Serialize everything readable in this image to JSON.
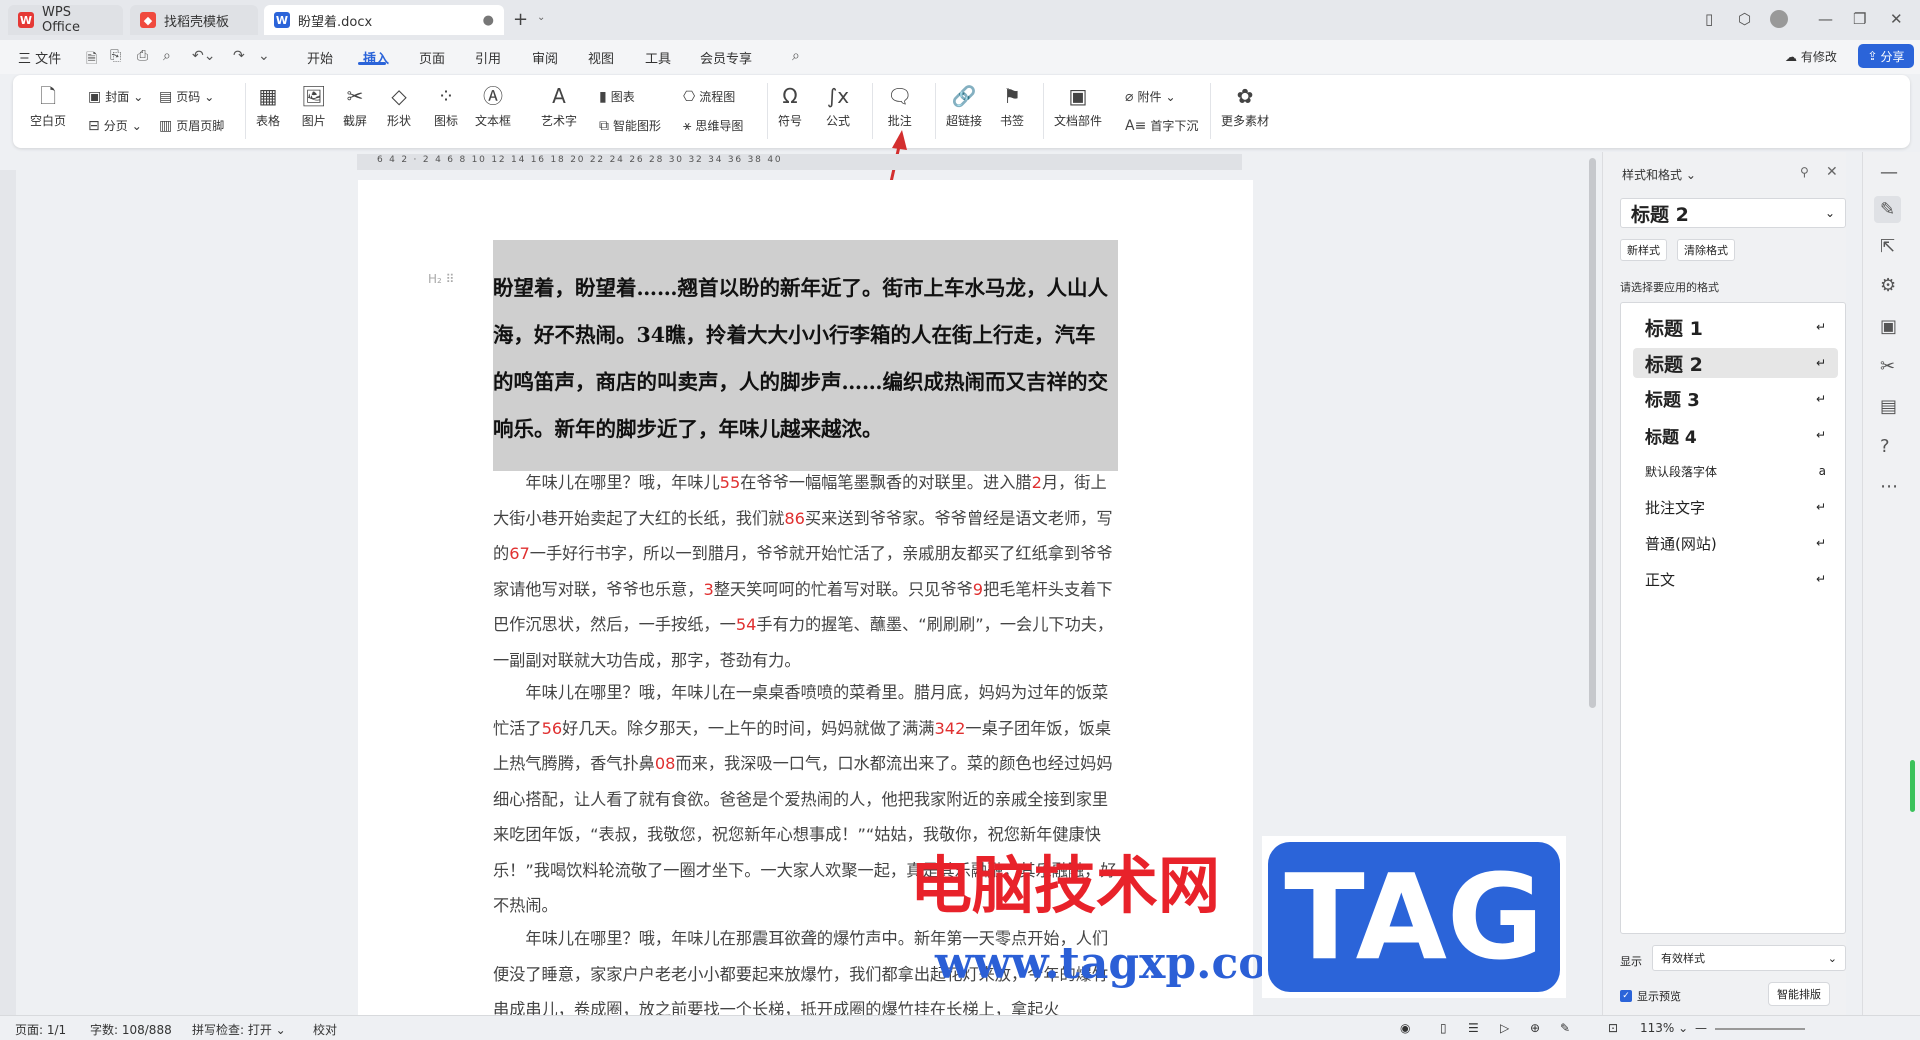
{
  "tabs": {
    "wps": "WPS Office",
    "templates": "找稻壳模板",
    "doc": "盼望着.docx"
  },
  "menu": {
    "file": "三 文件",
    "items": [
      "开始",
      "插入",
      "页面",
      "引用",
      "审阅",
      "视图",
      "工具",
      "会员专享"
    ],
    "modified": "有修改",
    "share": "分享"
  },
  "ribbon": {
    "blank_page": "空白页",
    "cover": "封面",
    "page_break": "分页",
    "page_number": "页码",
    "header_footer": "页眉页脚",
    "table": "表格",
    "picture": "图片",
    "screenshot": "截屏",
    "shape": "形状",
    "icon": "图标",
    "textbox": "文本框",
    "wordart": "艺术字",
    "chart": "图表",
    "smart_art": "智能图形",
    "flowchart": "流程图",
    "mindmap": "思维导图",
    "symbol": "符号",
    "formula": "公式",
    "comment": "批注",
    "hyperlink": "超链接",
    "bookmark": "书签",
    "doc_parts": "文档部件",
    "attachment": "附件",
    "dropcap": "首字下沉",
    "more": "更多素材"
  },
  "ruler_labels": "6   4   2   ·   2   4   6   8  10  12  14  16  18  20  22  24  26  28  30  32  34  36  38  40",
  "heading_marker": "H₂",
  "heading": "盼望着，盼望着……翘首以盼的新年近了。街市上车水马龙，人山人海，好不热闹。34瞧，拎着大大小小行李箱的人在街上行走，汽车的鸣笛声，商店的叫卖声，人的脚步声……编织成热闹而又吉祥的交响乐。新年的脚步近了，年味儿越来越浓。",
  "paragraphs": [
    [
      [
        "年味儿在哪里？哦，年味儿",
        ""
      ],
      [
        "55",
        "red"
      ],
      [
        "在爷爷一幅幅笔墨飘香的对联里。进入腊",
        ""
      ],
      [
        "2",
        "red"
      ],
      [
        "月，街上大街小巷开始卖起了大红的长纸，我们就",
        ""
      ],
      [
        "86",
        "red"
      ],
      [
        "买来送到爷爷家。爷爷曾经是语文老师，写的",
        ""
      ],
      [
        "67",
        "red"
      ],
      [
        "一手好行书字，所以一到腊月，爷爷就开始忙活了，亲戚朋友都买了红纸拿到爷爷家请他写对联，爷爷也乐意，",
        ""
      ],
      [
        "3",
        "red"
      ],
      [
        "整天笑呵呵的忙着写对联。只见爷爷",
        ""
      ],
      [
        "9",
        "red"
      ],
      [
        "把毛笔杆头支着下巴作沉思状，然后，一手按纸，一",
        ""
      ],
      [
        "54",
        "red"
      ],
      [
        "手有力的握笔、蘸墨、“刷刷刷”，一会儿下功夫，一副副对联就大功告成，那字，苍劲有力。",
        ""
      ]
    ],
    [
      [
        "年味儿在哪里？哦，年味儿在一桌桌香喷喷的菜肴里。腊月底，妈妈为过年的饭菜忙活了",
        ""
      ],
      [
        "56",
        "red"
      ],
      [
        "好几天。除夕那天，一上午的时间，妈妈就做了满满",
        ""
      ],
      [
        "342",
        "red"
      ],
      [
        "一桌子团年饭，饭桌上热气腾腾，香气扑鼻",
        ""
      ],
      [
        "08",
        "red"
      ],
      [
        "而来，我深吸一口气，口水都流出来了。菜的颜色也经过妈妈细心搭配，让人看了就有食欲。爸爸是个爱热闹的人，他把我家附近的亲戚全接到家里来吃团年饭，“表叔，我敬您，祝您新年心想事成！”“姑姑，我敬你，祝您新年健康快乐！”我喝饮料轮流敬了一圈才坐下。一大家人欢聚一起，真是其乐融融，其乐融融，好不热闹。",
        ""
      ]
    ],
    [
      [
        "年味儿在哪里？哦，年味儿在那震耳欲聋的爆竹声中。新年第一天零点开始，人们便没了睡意，家家户户老老小小都要起来放爆竹，我们都拿出起花灯来放，今年的爆竹串成串儿，卷成圈，放之前要找一个长梯，抵开成圈的爆竹挂在长梯上，拿起火",
        ""
      ]
    ]
  ],
  "right_pane": {
    "title": "样式和格式",
    "current": "标题  2",
    "new_style": "新样式",
    "clear": "清除格式",
    "apply_label": "请选择要应用的格式",
    "styles": [
      "标题  1",
      "标题  2",
      "标题  3",
      "标题  4",
      "默认段落字体",
      "批注文字",
      "普通(网站)",
      "正文"
    ],
    "show_label": "显示",
    "show_value": "有效样式",
    "preview": "显示预览",
    "smart": "智能排版"
  },
  "status": {
    "page": "页面: 1/1",
    "words": "字数: 108/888",
    "spell": "拼写检查: 打开 ⌄",
    "proof": "校对",
    "zoom": "113% ⌄"
  },
  "watermark": {
    "cn": "电脑技术网",
    "url": "www.tagxp.com",
    "tag": "TAG"
  }
}
